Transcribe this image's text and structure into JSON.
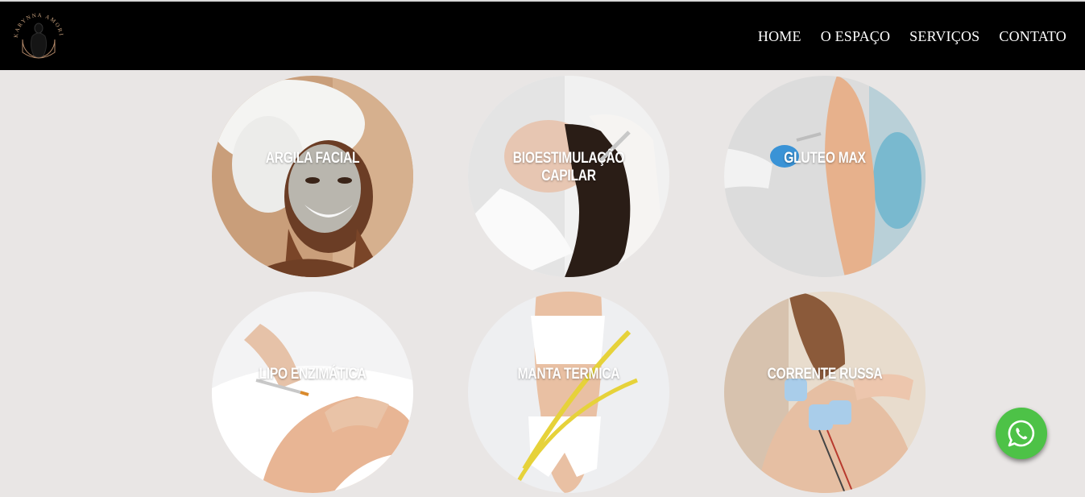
{
  "brand": {
    "logo_text": "KARYNNA AMORIM"
  },
  "nav": {
    "items": [
      {
        "label": "HOME"
      },
      {
        "label": "O ESPAÇO"
      },
      {
        "label": "SERVIÇOS"
      },
      {
        "label": "CONTATO"
      }
    ]
  },
  "services": [
    {
      "label": "ARGILA FACIAL"
    },
    {
      "label": "BIOESTIMULAÇÃO CAPILAR"
    },
    {
      "label": "GLUTEO MAX"
    },
    {
      "label": "LIPO ENZIMÁTICA"
    },
    {
      "label": "MANTA TERMICA"
    },
    {
      "label": "CORRENTE RUSSA"
    }
  ],
  "colors": {
    "header_bg": "#000000",
    "page_bg": "#e9e6e5",
    "whatsapp": "#4dc247"
  },
  "icons": {
    "whatsapp": "whatsapp-icon"
  }
}
